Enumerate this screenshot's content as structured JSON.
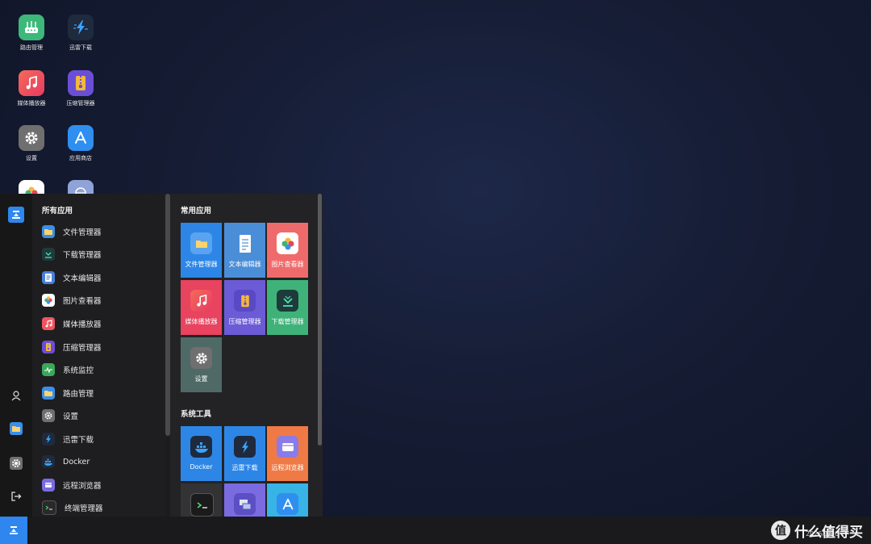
{
  "desktop": {
    "icons": [
      {
        "label": "路由管理",
        "icon": "router-icon",
        "color": "#3db87a"
      },
      {
        "label": "迅雷下载",
        "icon": "thunder-icon",
        "color": "#1f2a3d"
      },
      {
        "label": "媒体播放器",
        "icon": "music-icon",
        "color": "#f0555f"
      },
      {
        "label": "压缩管理器",
        "icon": "archive-icon",
        "color": "#6a4fd6"
      },
      {
        "label": "设置",
        "icon": "gear-icon",
        "color": "#6f6f6f"
      },
      {
        "label": "应用商店",
        "icon": "app-store-icon",
        "color": "#2f8ff0"
      },
      {
        "label": "",
        "icon": "photos-icon",
        "color": "#ffffff"
      },
      {
        "label": "",
        "icon": "remote-browser-icon",
        "color": "#8fa3d8"
      }
    ]
  },
  "start_menu": {
    "all_apps_title": "所有应用",
    "apps": [
      {
        "label": "文件管理器",
        "icon": "folder-icon",
        "color": "#3a8fe8"
      },
      {
        "label": "下载管理器",
        "icon": "download-icon",
        "color": "#1d3b3a"
      },
      {
        "label": "文本编辑器",
        "icon": "document-icon",
        "color": "#4a7fd6"
      },
      {
        "label": "图片查看器",
        "icon": "photos-icon",
        "color": "#ffffff"
      },
      {
        "label": "媒体播放器",
        "icon": "music-icon",
        "color": "#f0555f"
      },
      {
        "label": "压缩管理器",
        "icon": "archive-icon",
        "color": "#6a4fd6"
      },
      {
        "label": "系统监控",
        "icon": "monitor-icon",
        "color": "#3aa85a"
      },
      {
        "label": "路由管理",
        "icon": "folder-icon",
        "color": "#3a8fe8"
      },
      {
        "label": "设置",
        "icon": "gear-icon",
        "color": "#6f6f6f"
      },
      {
        "label": "迅雷下载",
        "icon": "thunder-icon",
        "color": "#1f2a3d"
      },
      {
        "label": "Docker",
        "icon": "docker-icon",
        "color": "#1f2a3d"
      },
      {
        "label": "远程浏览器",
        "icon": "remote-browser-icon",
        "color": "#7b6be0"
      },
      {
        "label": "终端管理器",
        "icon": "terminal-icon",
        "color": "#2a2a2a"
      }
    ],
    "frequent_title": "常用应用",
    "frequent": [
      {
        "label": "文件管理器",
        "icon": "folder-icon",
        "bg": "#2d86e6"
      },
      {
        "label": "文本编辑器",
        "icon": "document-icon",
        "bg": "#4a8ed8"
      },
      {
        "label": "图片查看器",
        "icon": "photos-icon",
        "bg": "#ef6b6b"
      },
      {
        "label": "媒体播放器",
        "icon": "music-icon",
        "bg": "#e8435f"
      },
      {
        "label": "压缩管理器",
        "icon": "archive-icon",
        "bg": "#6b5bd6"
      },
      {
        "label": "下载管理器",
        "icon": "download-icon",
        "bg": "#3fb27a"
      },
      {
        "label": "设置",
        "icon": "gear-icon",
        "bg": "#4f6a66"
      }
    ],
    "tools_title": "系统工具",
    "tools": [
      {
        "label": "Docker",
        "icon": "docker-icon",
        "bg": "#2d86e6"
      },
      {
        "label": "迅雷下载",
        "icon": "thunder-icon",
        "bg": "#2d86e6"
      },
      {
        "label": "远程浏览器",
        "icon": "remote-browser-icon",
        "bg": "#ef7a45"
      },
      {
        "label": "",
        "icon": "terminal-icon",
        "bg": "#333336"
      },
      {
        "label": "",
        "icon": "network-icon",
        "bg": "#7a6be0"
      },
      {
        "label": "",
        "icon": "app-store-icon",
        "bg": "#37b3e6"
      }
    ]
  },
  "taskbar": {
    "clock_date": "2026/1/16",
    "watermark": "什么值得买",
    "watermark_badge": "值"
  }
}
